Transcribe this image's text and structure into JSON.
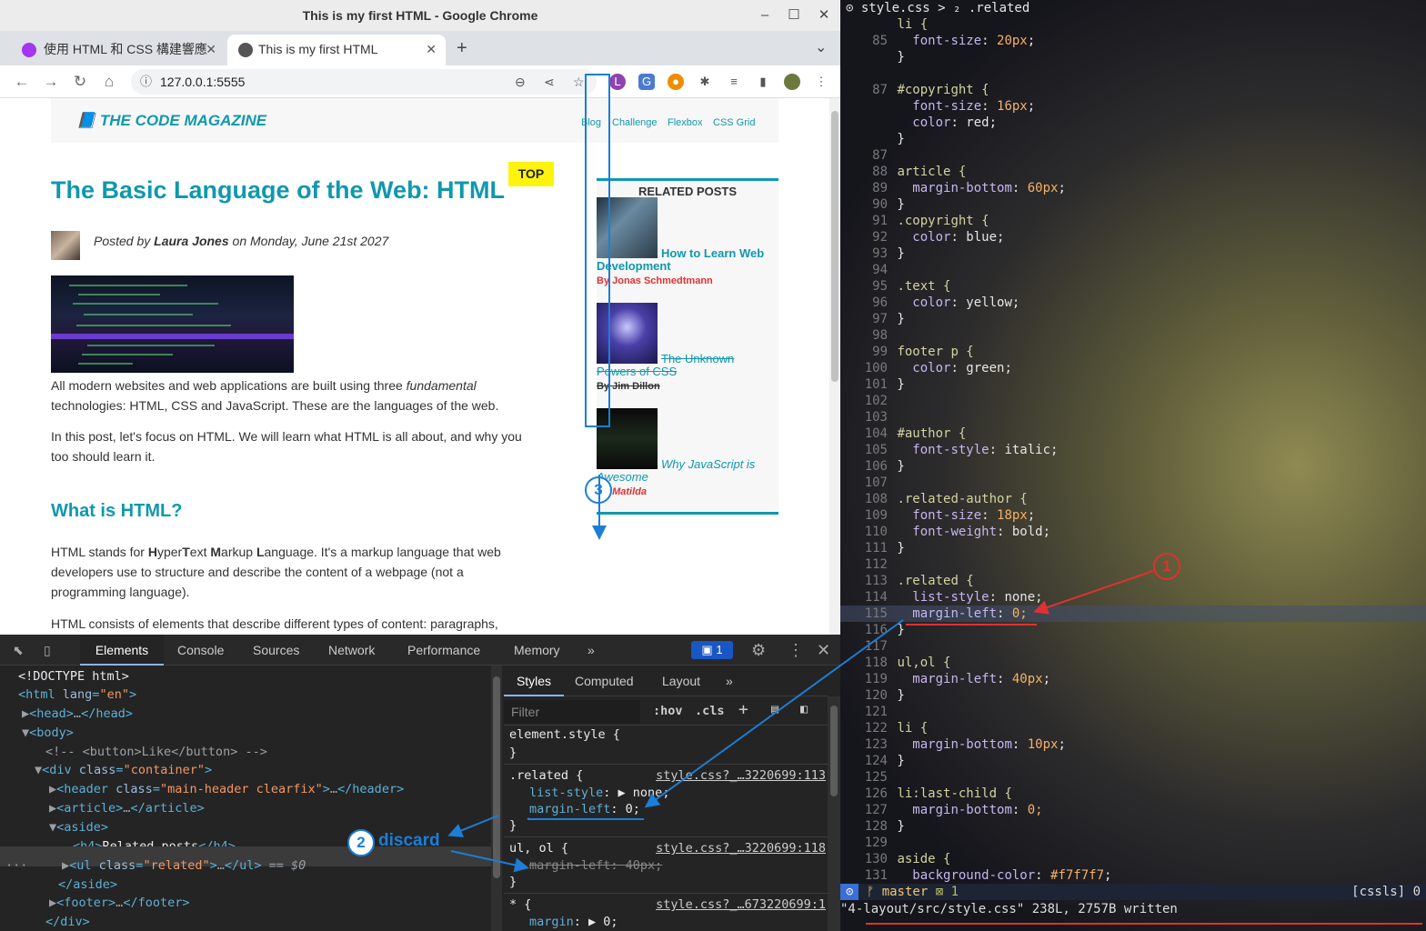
{
  "window": {
    "title": "This is my first HTML - Google Chrome"
  },
  "tabs": [
    {
      "label": "使用 HTML 和 CSS 構建響應",
      "close": "✕"
    },
    {
      "label": "This is my first HTML",
      "close": "✕"
    }
  ],
  "tabstrip": {
    "new_tab": "+",
    "dropdown": "⌄"
  },
  "toolbar": {
    "url": "127.0.0.1:5555"
  },
  "page": {
    "logo": "📘 THE CODE MAGAZINE",
    "nav": [
      "Blog",
      "Challenge",
      "Flexbox",
      "CSS Grid"
    ],
    "top_tag": "TOP",
    "title": "The Basic Language of the Web: HTML",
    "posted_prefix": "Posted by ",
    "author": "Laura Jones",
    "posted_suffix": " on Monday, June 21st 2027",
    "p1a": "All modern websites and web applications are built using three ",
    "p1b": "fundamental",
    "p1c": " technologies: HTML, CSS and JavaScript. These are the languages of the web.",
    "p2": "In this post, let's focus on HTML. We will learn what HTML is all about, and why you too should learn it.",
    "h2": "What is HTML?",
    "p3a": "HTML stands for ",
    "p3b": " It's a markup language that web developers use to structure and describe the content of a webpage (not a programming language).",
    "p3_letters": [
      "H",
      "yper",
      "T",
      "ext ",
      "M",
      "arkup ",
      "L",
      "anguage."
    ],
    "p4": "HTML consists of elements that describe different types of content: paragraphs,",
    "related": {
      "heading": "RELATED POSTS",
      "items": [
        {
          "title": "How to Learn Web Development",
          "author": "By Jonas Schmedtmann"
        },
        {
          "title": "The Unknown Powers of CSS",
          "author": "By Jim Dillon"
        },
        {
          "title": "Why JavaScript is Awesome",
          "author": "By Matilda"
        }
      ]
    }
  },
  "annotations": {
    "three": "3",
    "one": "1",
    "two": "2",
    "discard": "discard"
  },
  "devtools": {
    "tabs": [
      "Elements",
      "Console",
      "Sources",
      "Network",
      "Performance",
      "Memory",
      "»"
    ],
    "issues": "1",
    "dom": {
      "doctype": "<!DOCTYPE html>",
      "html_open": "<html ",
      "html_attr": "lang",
      "html_val": "\"en\"",
      "head": "<head>",
      "head_close": "</head>",
      "body": "<body>",
      "comment": "<!-- <button>Like</button> -->",
      "div": "<div ",
      "div_class": "class",
      "div_val": "\"container\"",
      "header": "<header ",
      "header_val": "\"main-header clearfix\"",
      "header_close": "</header>",
      "article": "<article>",
      "article_close": "</article>",
      "aside": "<aside>",
      "h4_open": "<h4>",
      "h4_text": "Related posts",
      "h4_close": "</h4>",
      "ul": "<ul ",
      "ul_val": "\"related\"",
      "ul_close": "</ul>",
      "eq": "== $0",
      "aside_close": "</aside>",
      "footer": "<footer>",
      "footer_close": "</footer>",
      "div_close": "</div>",
      "ellipsis": "…",
      "row_dots": "···",
      "gt": ">",
      "eqsign": "="
    },
    "styles": {
      "tabs": [
        "Styles",
        "Computed",
        "Layout",
        "»"
      ],
      "filter_placeholder": "Filter",
      "hov": ":hov",
      "cls": ".cls",
      "plus": "+",
      "rules": [
        {
          "selector": "element.style {",
          "close": "}"
        },
        {
          "selector": ".related {",
          "source": "style.css?_…3220699:113",
          "props": [
            {
              "name": "list-style",
              "value": "▶ none;"
            },
            {
              "name": "margin-left",
              "value": "0;"
            }
          ],
          "close": "}"
        },
        {
          "selector": "ul, ol {",
          "source": "style.css?_…3220699:118",
          "props": [
            {
              "name": "margin-left",
              "value": "40px;"
            }
          ],
          "close": "}"
        },
        {
          "selector": "* {",
          "source": "style.css?_…673220699:1",
          "props": [
            {
              "name": "margin",
              "value": "▶ 0;"
            }
          ]
        }
      ]
    }
  },
  "vim": {
    "breadcrumb": "⊙ style.css > ₂ .related",
    "lines": [
      {
        "n": "",
        "t": "li {"
      },
      {
        "n": "85",
        "t": "  font-size: 20px;"
      },
      {
        "n": "",
        "t": "}"
      },
      {
        "n": "",
        "t": ""
      },
      {
        "n": "87",
        "t": "#copyright {"
      },
      {
        "n": "",
        "t": "  font-size: 16px;"
      },
      {
        "n": "",
        "t": "  color: red;"
      },
      {
        "n": "",
        "t": "}"
      },
      {
        "n": "87",
        "t": ""
      },
      {
        "n": "88",
        "t": "article {"
      },
      {
        "n": "89",
        "t": "  margin-bottom: 60px;"
      },
      {
        "n": "90",
        "t": "}"
      },
      {
        "n": "91",
        "t": ".copyright {"
      },
      {
        "n": "92",
        "t": "  color: blue;"
      },
      {
        "n": "93",
        "t": "}"
      },
      {
        "n": "94",
        "t": ""
      },
      {
        "n": "95",
        "t": ".text {"
      },
      {
        "n": "96",
        "t": "  color: yellow;"
      },
      {
        "n": "97",
        "t": "}"
      },
      {
        "n": "98",
        "t": ""
      },
      {
        "n": "99",
        "t": "footer p {"
      },
      {
        "n": "100",
        "t": "  color: green;"
      },
      {
        "n": "101",
        "t": "}"
      },
      {
        "n": "102",
        "t": ""
      },
      {
        "n": "103",
        "t": ""
      },
      {
        "n": "104",
        "t": "#author {"
      },
      {
        "n": "105",
        "t": "  font-style: italic;"
      },
      {
        "n": "106",
        "t": "}"
      },
      {
        "n": "107",
        "t": ""
      },
      {
        "n": "108",
        "t": ".related-author {"
      },
      {
        "n": "109",
        "t": "  font-size: 18px;"
      },
      {
        "n": "110",
        "t": "  font-weight: bold;"
      },
      {
        "n": "111",
        "t": "}"
      },
      {
        "n": "112",
        "t": ""
      },
      {
        "n": "113",
        "t": ".related {"
      },
      {
        "n": "114",
        "t": "  list-style: none;"
      },
      {
        "n": "115",
        "t": "  margin-left: 0;"
      },
      {
        "n": "116",
        "t": "}"
      },
      {
        "n": "117",
        "t": ""
      },
      {
        "n": "118",
        "t": "ul,ol {"
      },
      {
        "n": "119",
        "t": "  margin-left: 40px;"
      },
      {
        "n": "120",
        "t": "}"
      },
      {
        "n": "121",
        "t": ""
      },
      {
        "n": "122",
        "t": "li {"
      },
      {
        "n": "123",
        "t": "  margin-bottom: 10px;"
      },
      {
        "n": "124",
        "t": "}"
      },
      {
        "n": "125",
        "t": ""
      },
      {
        "n": "126",
        "t": "li:last-child {"
      },
      {
        "n": "127",
        "t": "  margin-bottom: 0;"
      },
      {
        "n": "128",
        "t": "}"
      },
      {
        "n": "129",
        "t": ""
      },
      {
        "n": "130",
        "t": "aside {"
      },
      {
        "n": "131",
        "t": "  background-color: #f7f7f7;"
      }
    ],
    "status_mode": "⊙",
    "status_branch": "ᚠ master",
    "status_diag": "⊠ 1",
    "status_lsp": "[cssls] 0",
    "message": "\"4-layout/src/style.css\" 238L, 2757B written"
  },
  "colors": {
    "accent": "#1098ad",
    "annotation_blue": "#1c7ed6",
    "annotation_red": "#e03131",
    "top_yellow": "#fdf30c"
  }
}
